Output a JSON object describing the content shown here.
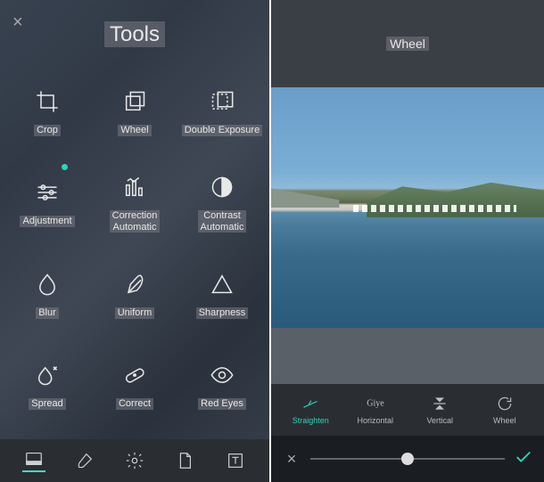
{
  "left": {
    "title": "Tools",
    "close": "×",
    "tools": [
      {
        "label": "Crop",
        "icon": "crop-icon"
      },
      {
        "label": "Wheel",
        "icon": "rotate-icon"
      },
      {
        "label": "Double Exposure",
        "icon": "double-exposure-icon"
      },
      {
        "label": "Adjustment",
        "icon": "sliders-icon",
        "badge": true
      },
      {
        "label": "Correction\nAutomatic",
        "icon": "auto-correct-icon"
      },
      {
        "label": "Contrast\nAutomatic",
        "icon": "contrast-icon"
      },
      {
        "label": "Blur",
        "icon": "droplet-icon"
      },
      {
        "label": "Uniform",
        "icon": "feather-icon"
      },
      {
        "label": "Sharpness",
        "icon": "triangle-icon"
      },
      {
        "label": "Spread",
        "icon": "spread-icon"
      },
      {
        "label": "Correct",
        "icon": "bandage-icon"
      },
      {
        "label": "Red Eyes",
        "icon": "eye-icon"
      }
    ],
    "bottom_tabs": [
      {
        "icon": "photo-icon",
        "active": true
      },
      {
        "icon": "brush-icon"
      },
      {
        "icon": "gear-icon"
      },
      {
        "icon": "page-icon"
      },
      {
        "icon": "text-icon"
      }
    ]
  },
  "right": {
    "title": "Wheel",
    "transforms": [
      {
        "label": "Straighten",
        "icon": "straighten-icon",
        "active": true
      },
      {
        "label": "Giye",
        "sublabel": "Horizontal",
        "icon": "flip-h-icon"
      },
      {
        "label": "Vertical",
        "icon": "flip-v-icon"
      },
      {
        "label": "Wheel",
        "icon": "rotate-cw-icon"
      }
    ],
    "slider": {
      "cancel": "×",
      "confirm": "✓"
    }
  }
}
